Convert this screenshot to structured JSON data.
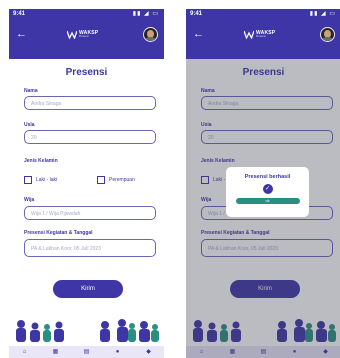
{
  "status": {
    "time": "9:41",
    "icons": "▮▮ ◢ ▭"
  },
  "app": {
    "logo_name": "WAKSP",
    "logo_sub": "Presensi"
  },
  "page": {
    "title": "Presensi"
  },
  "form": {
    "nama_label": "Nama",
    "nama_value": "Andra Sinaga",
    "usia_label": "Usia",
    "usia_value": "20",
    "gender_label": "Jenis Kelamin",
    "gender_male": "Laki - laki",
    "gender_female": "Perempuan",
    "wija_label": "Wija",
    "wija_placeholder": "Wija 1 / Wija Pijewdah",
    "kegiatan_label": "Presensi Kegiatan & Tanggal",
    "kegiatan_value": "PA & Latihan Koor, 05 Juli 2023",
    "submit_label": "Kirim"
  },
  "modal": {
    "title": "Presensi berhasil",
    "ok_label": "ok"
  },
  "nav": [
    {
      "icon": "home-icon"
    },
    {
      "icon": "grid-icon"
    },
    {
      "icon": "document-icon"
    },
    {
      "icon": "user-icon"
    },
    {
      "icon": "gift-icon"
    }
  ],
  "colors": {
    "primary": "#3e36a6",
    "accent": "#2a8f83",
    "nav_bg": "#e9e7f7"
  }
}
